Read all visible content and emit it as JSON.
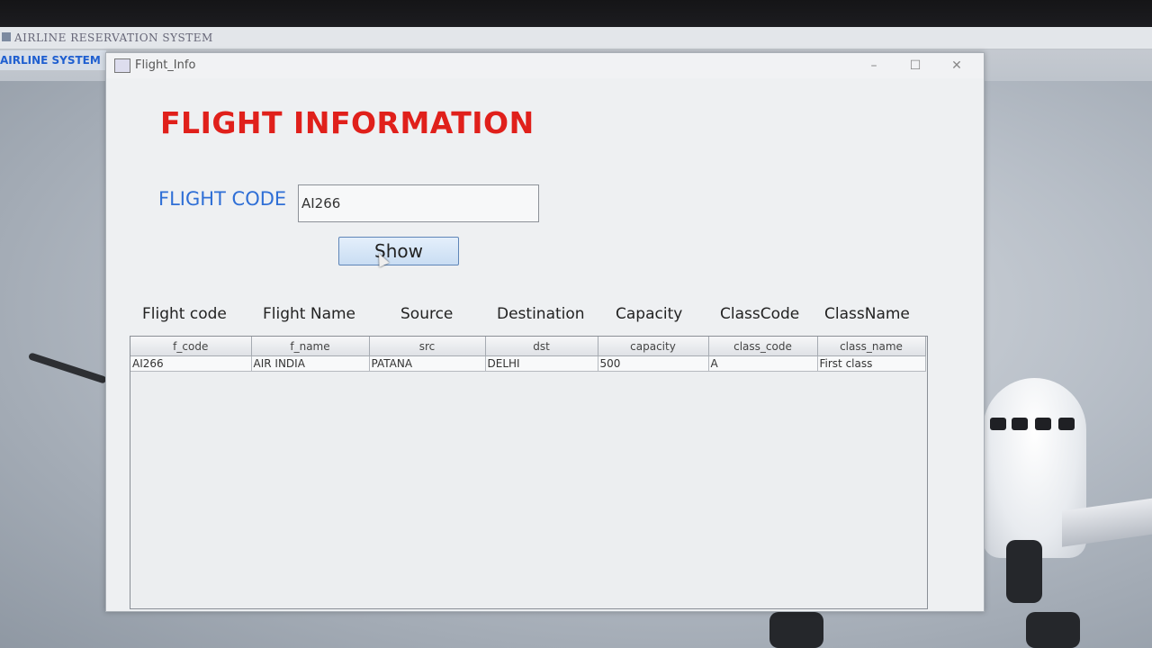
{
  "desktop": {
    "app_title": "AIRLINE RESERVATION SYSTEM",
    "menu_label": "AIRLINE SYSTEM"
  },
  "window": {
    "title": "Flight_Info",
    "minimize_symbol": "–",
    "maximize_symbol": "☐",
    "close_symbol": "✕"
  },
  "form": {
    "heading": "FLIGHT INFORMATION",
    "code_label": "FLIGHT CODE",
    "code_value": "AI266",
    "show_label": "Show"
  },
  "column_labels": [
    "Flight code",
    "Flight Name",
    "Source",
    "Destination",
    "Capacity",
    "ClassCode",
    "ClassName"
  ],
  "table": {
    "headers": [
      "f_code",
      "f_name",
      "src",
      "dst",
      "capacity",
      "class_code",
      "class_name"
    ],
    "rows": [
      [
        "AI266",
        "AIR INDIA",
        "PATANA",
        "DELHI",
        "500",
        "A",
        "First class"
      ]
    ]
  },
  "colors": {
    "heading": "#e0201b",
    "label_blue": "#2f6fd6"
  }
}
